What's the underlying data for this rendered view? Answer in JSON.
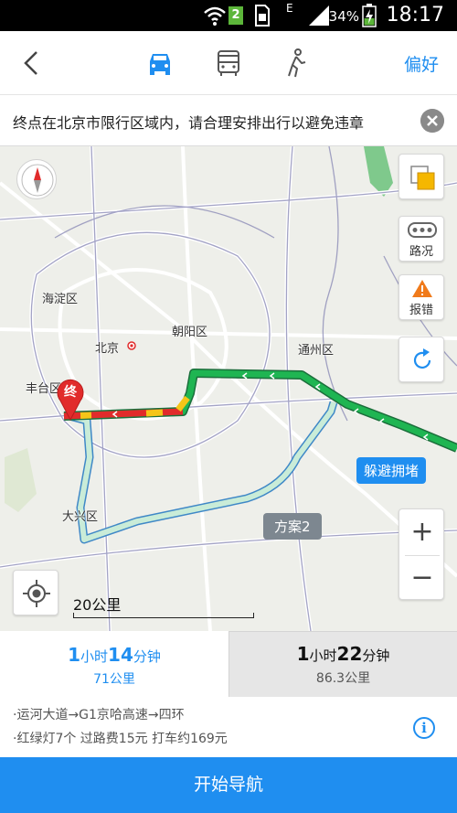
{
  "status_bar": {
    "sim_slot": "2",
    "network": "E",
    "battery": "34%",
    "time": "18:17"
  },
  "nav": {
    "modes": [
      {
        "name": "drive",
        "icon": "car-icon",
        "active": true
      },
      {
        "name": "transit",
        "icon": "bus-icon",
        "active": false
      },
      {
        "name": "walk",
        "icon": "walk-icon",
        "active": false
      }
    ],
    "preference_label": "偏好"
  },
  "notice": {
    "text": "终点在北京市限行区域内，请合理安排出行以避免违章"
  },
  "map": {
    "labels": {
      "haidian": "海淀区",
      "beijing": "北京",
      "chaoyang": "朝阳区",
      "tongzhou": "通州区",
      "fengtai": "丰台区",
      "daxing": "大兴区"
    },
    "end_marker": "终",
    "traffic_label": "路况",
    "report_label": "报错",
    "congestion_tag": "躲避拥堵",
    "alt_route_tag": "方案2",
    "zoom_in": "+",
    "zoom_out": "−",
    "scale": "20公里"
  },
  "routes": [
    {
      "hours": "1",
      "hour_unit": "小时",
      "minutes": "14",
      "minute_unit": "分钟",
      "distance": "71公里",
      "selected": true
    },
    {
      "hours": "1",
      "hour_unit": "小时",
      "minutes": "22",
      "minute_unit": "分钟",
      "distance": "86.3公里",
      "selected": false
    }
  ],
  "details": {
    "path": "·运河大道→G1京哈高速→四环",
    "costs": "·红绿灯7个  过路费15元  打车约169元"
  },
  "start_button": "开始导航",
  "colors": {
    "accent": "#1f8ef0",
    "route_green": "#1fb552",
    "congestion_red": "#e12b2b",
    "slow_yellow": "#f5c518"
  }
}
